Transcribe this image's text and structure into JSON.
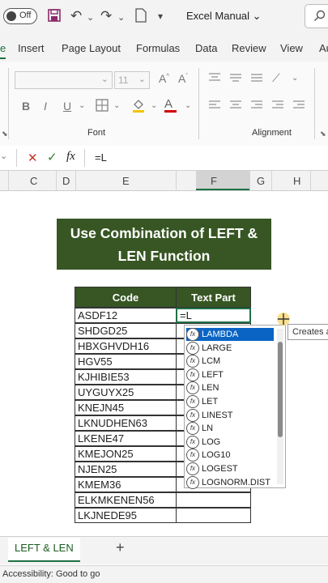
{
  "titlebar": {
    "autosave_label": "Off",
    "doc_title": "Excel Manual",
    "icons": [
      "save-icon",
      "undo-icon",
      "redo-icon",
      "new-file-icon",
      "customize-icon",
      "chevron-down-icon",
      "search-icon"
    ]
  },
  "tabs": [
    {
      "label": "e"
    },
    {
      "label": "Insert"
    },
    {
      "label": "Page Layout"
    },
    {
      "label": "Formulas"
    },
    {
      "label": "Data"
    },
    {
      "label": "Review"
    },
    {
      "label": "View"
    },
    {
      "label": "Au"
    }
  ],
  "ribbon": {
    "font_group_label": "Font",
    "alignment_group_label": "Alignment",
    "font_size": "11",
    "font_buttons": [
      "B",
      "I",
      "U"
    ]
  },
  "formula_bar": {
    "cancel_icon": "cancel-icon",
    "confirm_icon": "confirm-icon",
    "fx_label": "fx",
    "content": "=L"
  },
  "columns": [
    "C",
    "D",
    "E",
    "F",
    "G",
    "H"
  ],
  "banner": {
    "line1": "Use Combination of LEFT &",
    "line2": "LEN Function"
  },
  "table": {
    "headers": [
      "Code",
      "Text Part"
    ],
    "rows": [
      {
        "code": "ASDF12",
        "part": "=L"
      },
      {
        "code": "SHDGD25",
        "part": ""
      },
      {
        "code": "HBXGHVDH16",
        "part": ""
      },
      {
        "code": "HGV55",
        "part": ""
      },
      {
        "code": "KJHIBIE53",
        "part": ""
      },
      {
        "code": "UYGUYX25",
        "part": ""
      },
      {
        "code": "KNEJN45",
        "part": ""
      },
      {
        "code": "LKNUDHEN63",
        "part": ""
      },
      {
        "code": "LKENE47",
        "part": ""
      },
      {
        "code": "KMEJON25",
        "part": ""
      },
      {
        "code": "NJEN25",
        "part": ""
      },
      {
        "code": "KMEM36",
        "part": ""
      },
      {
        "code": "ELKMKENEN56",
        "part": ""
      },
      {
        "code": "LKJNEDE95",
        "part": ""
      }
    ]
  },
  "autocomplete": {
    "items": [
      "LAMBDA",
      "LARGE",
      "LCM",
      "LEFT",
      "LEN",
      "LET",
      "LINEST",
      "LN",
      "LOG",
      "LOG10",
      "LOGEST",
      "LOGNORM.DIST"
    ],
    "selected_index": 0,
    "tooltip": "Creates a"
  },
  "sheet": {
    "active_tab": "LEFT & LEN",
    "add_label": "+"
  },
  "status": {
    "text": "Accessibility: Good to go"
  }
}
